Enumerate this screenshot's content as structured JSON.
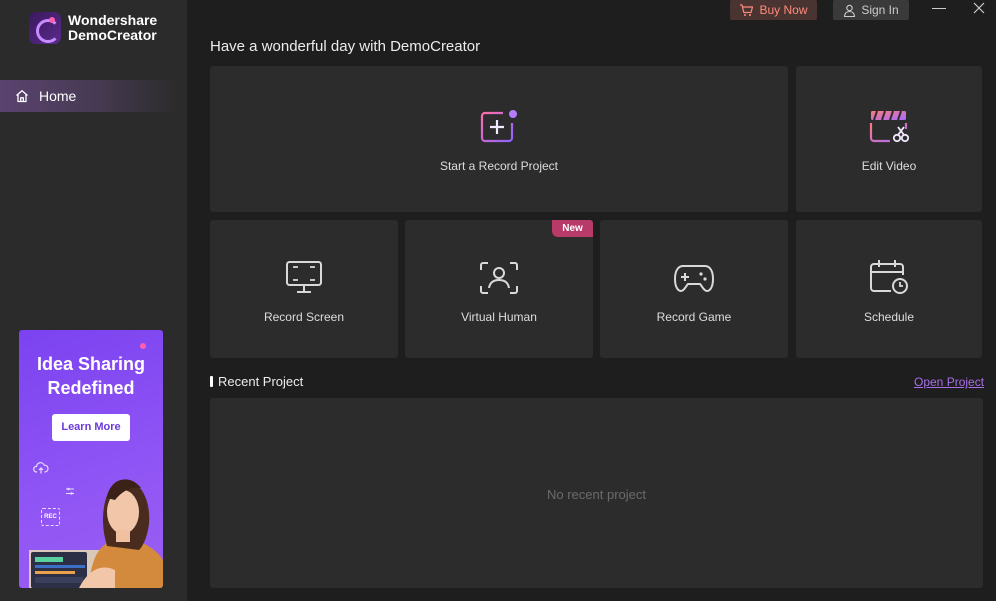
{
  "brand": {
    "line1": "Wondershare",
    "line2": "DemoCreator"
  },
  "sidebar": {
    "home_label": "Home"
  },
  "ad": {
    "title_line1": "Idea Sharing",
    "title_line2": "Redefined",
    "button": "Learn More",
    "rec_label": "REC"
  },
  "topbar": {
    "buy_now": "Buy Now",
    "sign_in": "Sign In",
    "minimize": "—",
    "close": "✕"
  },
  "greeting": "Have a wonderful day with DemoCreator",
  "cards": {
    "start_record": "Start a Record Project",
    "edit_video": "Edit Video",
    "record_screen": "Record Screen",
    "virtual_human": "Virtual Human",
    "virtual_human_badge": "New",
    "record_game": "Record Game",
    "schedule": "Schedule"
  },
  "recent": {
    "title": "Recent Project",
    "open_link": "Open Project",
    "empty": "No recent project"
  },
  "colors": {
    "accent": "#a76ee8",
    "badge": "#b83a68",
    "buy_icon": "#ff8c7a",
    "ad_bg": "#8f54f5"
  }
}
